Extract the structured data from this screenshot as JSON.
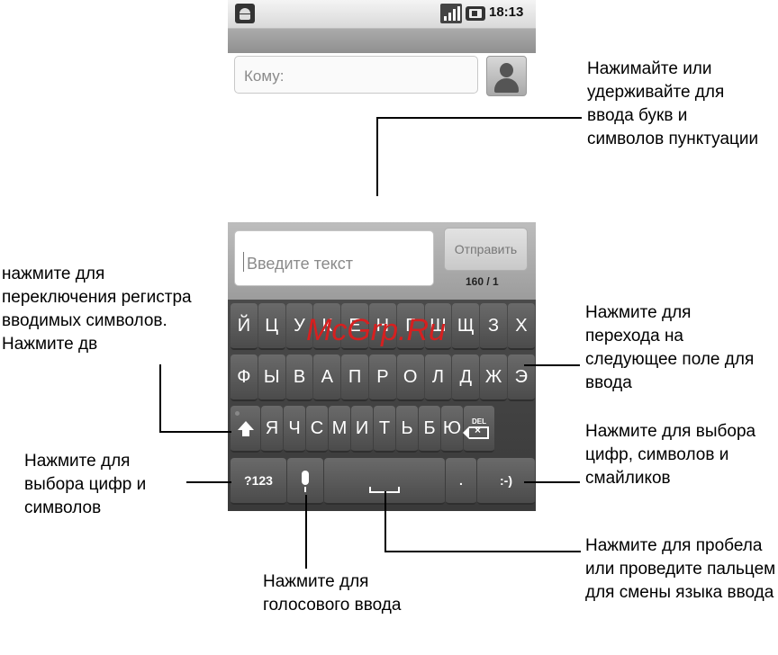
{
  "status_bar": {
    "time": "18:13"
  },
  "compose": {
    "to_placeholder": "Кому:",
    "message_placeholder": "Введите текст",
    "send_label": "Отправить",
    "char_counter": "160 / 1"
  },
  "keyboard": {
    "row1": [
      "Й",
      "Ц",
      "У",
      "К",
      "Е",
      "Н",
      "Г",
      "Ш",
      "Щ",
      "З",
      "Х"
    ],
    "row2": [
      "Ф",
      "Ы",
      "В",
      "А",
      "П",
      "Р",
      "О",
      "Л",
      "Д",
      "Ж",
      "Э"
    ],
    "row3": [
      "Я",
      "Ч",
      "С",
      "М",
      "И",
      "Т",
      "Ь",
      "Б",
      "Ю"
    ],
    "del_label": "DEL",
    "symbols_label": "?123",
    "period_label": ".",
    "smiley_label": ":-)"
  },
  "watermark": "McGrp.Ru",
  "callouts": {
    "typing": "Нажимайте или удерживайте для ввода букв и символов пунктуации",
    "shift": "нажмите для переключения регистра вводимых символов. Нажмите дв",
    "next_field": "Нажмите для перехода на следующее поле для ввода",
    "symbols": "Нажмите для выбора цифр и символов",
    "smileys": "Нажмите для выбора цифр, символов и смайликов",
    "voice": "Нажмите для голосового ввода",
    "space": "Нажмите для пробела или проведите пальцем для смены языка ввода"
  }
}
